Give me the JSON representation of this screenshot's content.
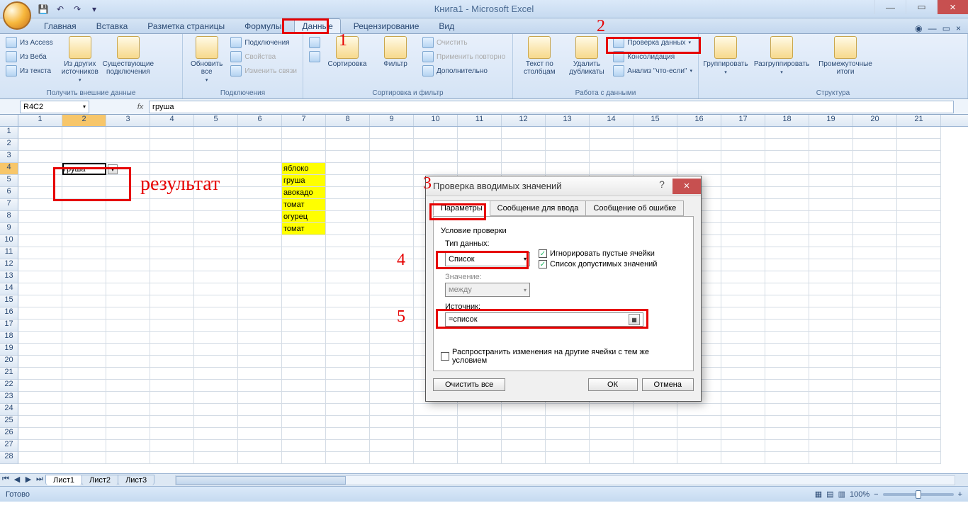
{
  "title": "Книга1 - Microsoft Excel",
  "tabs": [
    "Главная",
    "Вставка",
    "Разметка страницы",
    "Формулы",
    "Данные",
    "Рецензирование",
    "Вид"
  ],
  "active_tab_index": 4,
  "namebox": "R4C2",
  "formula": "груша",
  "ribbon_groups": {
    "g1": {
      "label": "Получить внешние данные",
      "items": [
        "Из Access",
        "Из Веба",
        "Из текста",
        "Из других источников",
        "Существующие подключения"
      ]
    },
    "g2": {
      "label": "Подключения",
      "big": "Обновить все",
      "items": [
        "Подключения",
        "Свойства",
        "Изменить связи"
      ]
    },
    "g3": {
      "label": "Сортировка и фильтр",
      "sort_az": "А↓Я",
      "sort_za": "Я↓А",
      "sort": "Сортировка",
      "filter": "Фильтр",
      "clear": "Очистить",
      "reapply": "Применить повторно",
      "advanced": "Дополнительно"
    },
    "g4": {
      "label": "Работа с данными",
      "textcol": "Текст по столбцам",
      "remdup": "Удалить дубликаты",
      "validate": "Проверка данных",
      "consol": "Консолидация",
      "whatif": "Анализ \"что-если\""
    },
    "g5": {
      "label": "Структура",
      "group": "Группировать",
      "ungroup": "Разгруппировать",
      "subtotal": "Промежуточные итоги"
    }
  },
  "cells": {
    "b4": "груша",
    "g4": "яблоко",
    "g5": "груша",
    "g6": "авокадо",
    "g7": "томат",
    "g8": "огурец",
    "g9": "томат"
  },
  "result_label": "результат",
  "dialog": {
    "title": "Проверка вводимых значений",
    "tabs": [
      "Параметры",
      "Сообщение для ввода",
      "Сообщение об ошибке"
    ],
    "condition_label": "Условие проверки",
    "type_label": "Тип данных:",
    "type_value": "Список",
    "between_label": "Значение:",
    "between_value": "между",
    "ignore_blank": "Игнорировать пустые ячейки",
    "in_cell_dd": "Список допустимых значений",
    "source_label": "Источник:",
    "source_value": "=список",
    "propagate": "Распространить изменения на другие ячейки с тем же условием",
    "clear": "Очистить все",
    "ok": "ОК",
    "cancel": "Отмена"
  },
  "sheets": [
    "Лист1",
    "Лист2",
    "Лист3"
  ],
  "status": "Готово",
  "zoom": "100%",
  "annotations": {
    "n1": "1",
    "n2": "2",
    "n3": "3",
    "n4": "4",
    "n5": "5"
  }
}
